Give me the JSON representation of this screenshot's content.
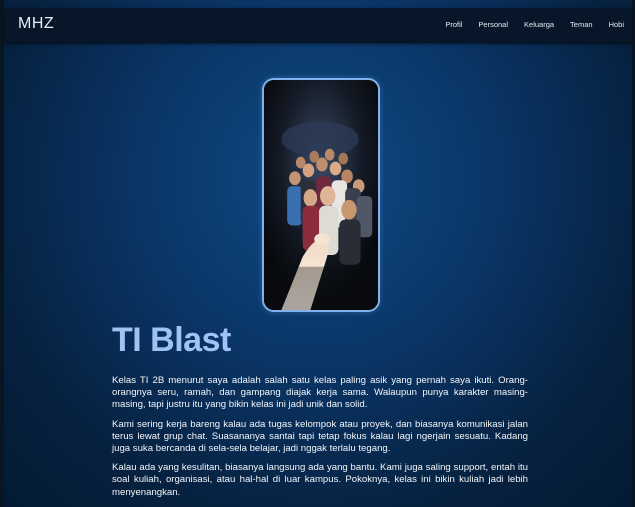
{
  "navbar": {
    "brand": "MHZ",
    "links": [
      "Profil",
      "Personal",
      "Keluarga",
      "Teman",
      "Hobi"
    ]
  },
  "main": {
    "title": "TI Blast",
    "paragraphs": [
      "Kelas TI 2B menurut saya adalah salah satu kelas paling asik yang pernah saya ikuti. Orang-orangnya seru, ramah, dan gampang diajak kerja sama. Walaupun punya karakter masing-masing, tapi justru itu yang bikin kelas ini jadi unik dan solid.",
      "Kami sering kerja bareng kalau ada tugas kelompok atau proyek, dan biasanya komunikasi jalan terus lewat grup chat. Suasananya santai tapi tetap fokus kalau lagi ngerjain sesuatu. Kadang juga suka bercanda di sela-sela belajar, jadi nggak terlalu tegang.",
      "Kalau ada yang kesulitan, biasanya langsung ada yang bantu. Kami juga saling support, entah itu soal kuliah, organisasi, atau hal-hal di luar kampus. Pokoknya, kelas ini bikin kuliah jadi lebih menyenangkan."
    ]
  },
  "colors": {
    "background": "#0a3566",
    "navbar": "#071628",
    "title": "#9fc4f4",
    "photo_border": "#7fb2ee"
  }
}
